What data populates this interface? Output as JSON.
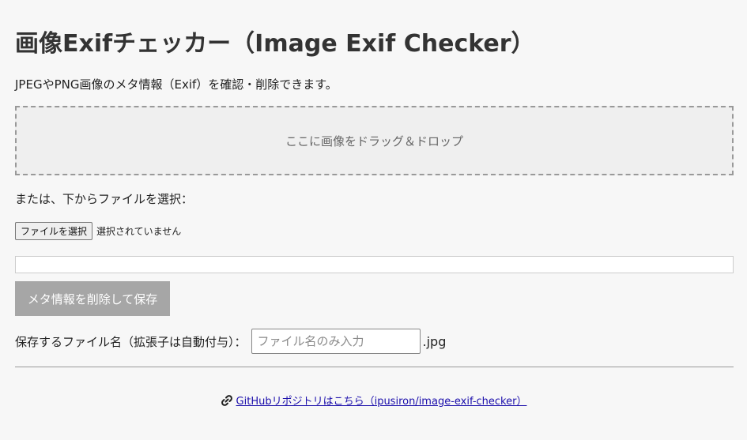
{
  "header": {
    "title": "画像Exifチェッカー（Image Exif Checker）",
    "description": "JPEGやPNG画像のメタ情報（Exif）を確認・削除できます。"
  },
  "dropzone": {
    "label": "ここに画像をドラッグ＆ドロップ"
  },
  "file_select": {
    "intro": "または、下からファイルを選択：",
    "button_label": "ファイルを選択",
    "status": "選択されていません"
  },
  "actions": {
    "remove_label": "メタ情報を削除して保存"
  },
  "save": {
    "label": "保存するファイル名（拡張子は自動付与）：",
    "placeholder": "ファイル名のみ入力",
    "value": "",
    "extension": ".jpg"
  },
  "footer": {
    "icon": "link-icon",
    "link_text": "GitHubリポジトリはこちら（ipusiron/image-exif-checker）"
  },
  "colors": {
    "background": "#f7f7f7",
    "button_disabled": "#a6a6a6",
    "link": "#1a0dab"
  }
}
